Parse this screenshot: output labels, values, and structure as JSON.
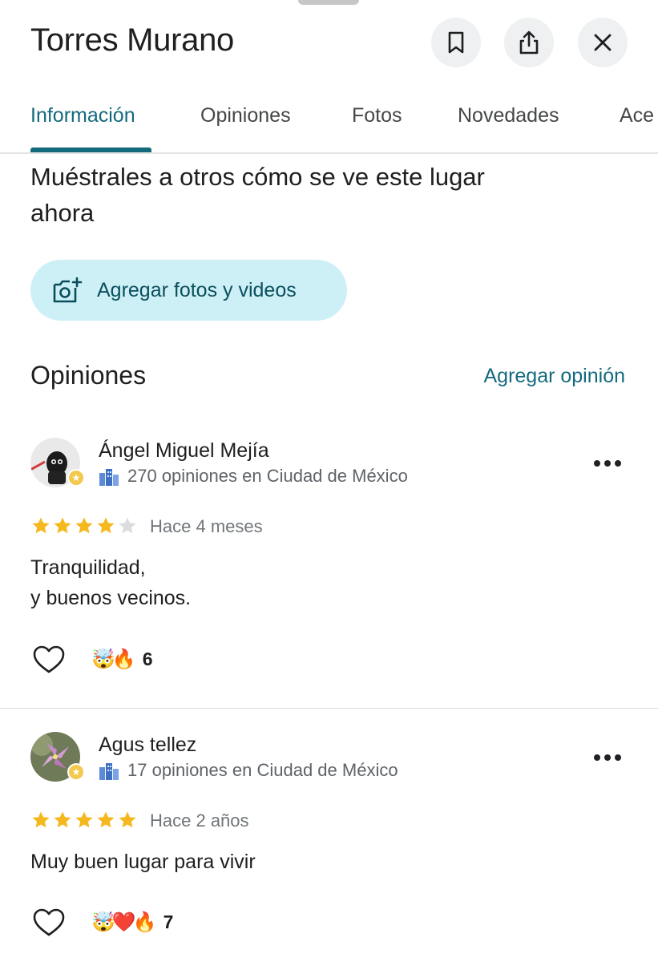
{
  "header": {
    "title": "Torres Murano"
  },
  "tabs": [
    {
      "label": "Información"
    },
    {
      "label": "Opiniones"
    },
    {
      "label": "Fotos"
    },
    {
      "label": "Novedades"
    },
    {
      "label": "Ace"
    }
  ],
  "prompt": {
    "text": "Muéstrales a otros cómo se ve este lugar ahora",
    "button_label": "Agregar fotos y videos"
  },
  "reviews_section": {
    "title": "Opiniones",
    "add_review_label": "Agregar opinión"
  },
  "reviews": [
    {
      "author": "Ángel Miguel Mejía",
      "meta": "270 opiniones en Ciudad de México",
      "rating": 4,
      "time": "Hace 4 meses",
      "text": "Tranquilidad,\ny buenos vecinos.",
      "reactions": "🤯🔥",
      "reaction_count": "6"
    },
    {
      "author": "Agus tellez",
      "meta": "17 opiniones en Ciudad de México",
      "rating": 5,
      "time": "Hace 2 años",
      "text": "Muy buen lugar para vivir",
      "reactions": "🤯❤️🔥",
      "reaction_count": "7"
    }
  ],
  "colors": {
    "accent": "#146a7d",
    "star": "#f5b91f",
    "star_empty": "#dadce0",
    "chip_bg": "#cdf0f7"
  }
}
